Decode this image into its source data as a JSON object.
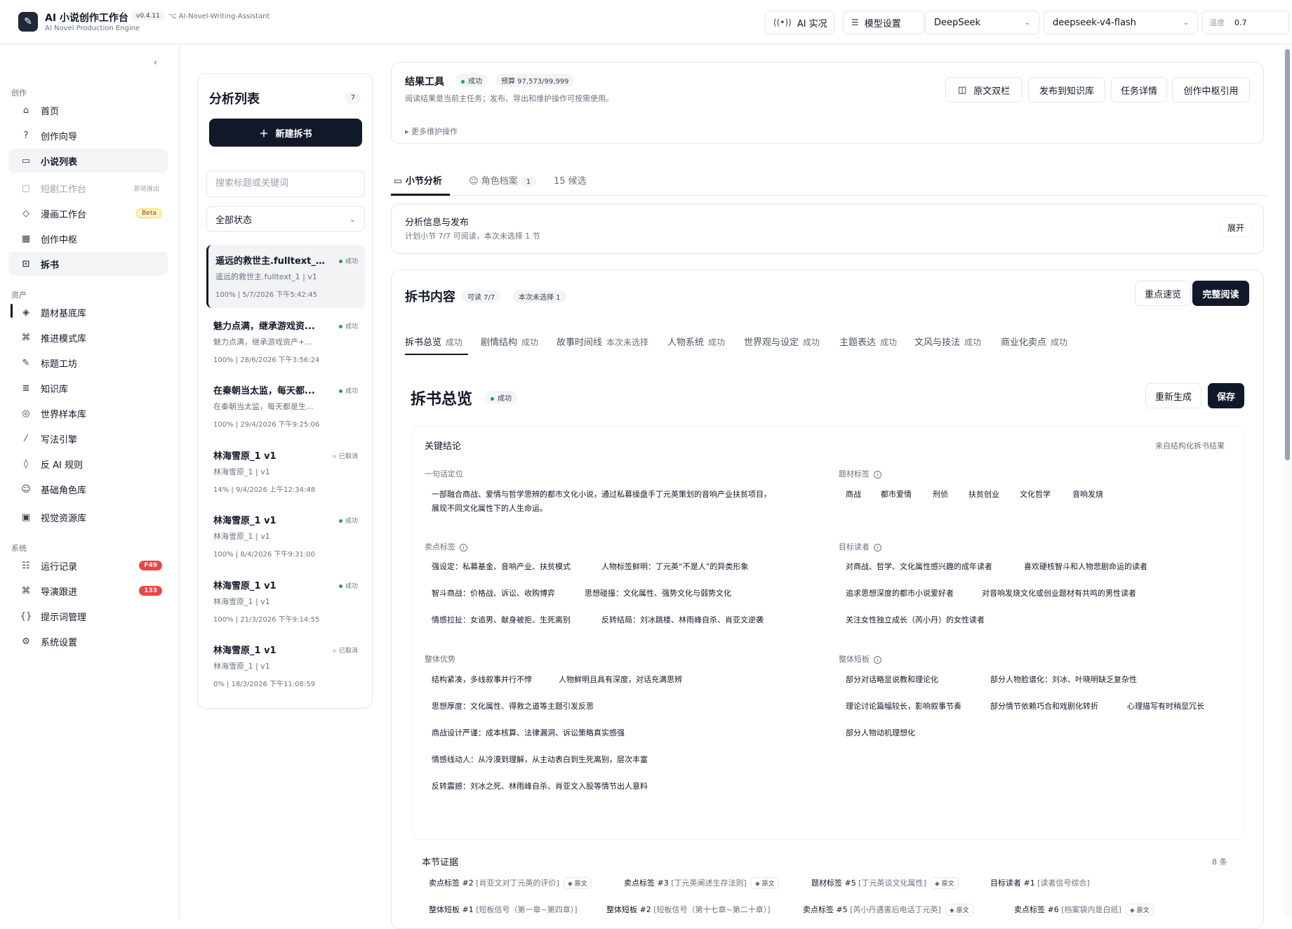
{
  "header": {
    "app_title": "AI 小说创作工作台",
    "app_subtitle": "AI Novel Production Engine",
    "version": "v0.4.11",
    "repo": "AI-Novel-Writing-Assistant",
    "live_button": "AI 实况",
    "model_settings_button": "模型设置",
    "provider_select": "DeepSeek",
    "model_select": "deepseek-v4-flash",
    "temperature_label": "温度",
    "temperature_value": "0.7"
  },
  "sidebar": {
    "section_create": "创作",
    "section_assets": "资产",
    "section_system": "系统",
    "items": [
      {
        "label": "首页"
      },
      {
        "label": "创作向导"
      },
      {
        "label": "小说列表"
      },
      {
        "label": "短剧工作台",
        "tag": "即将推出"
      },
      {
        "label": "漫画工作台",
        "badge": "Beta"
      },
      {
        "label": "创作中枢"
      },
      {
        "label": "拆书"
      },
      {
        "label": "题材基底库"
      },
      {
        "label": "推进模式库"
      },
      {
        "label": "标题工坊"
      },
      {
        "label": "知识库"
      },
      {
        "label": "世界样本库"
      },
      {
        "label": "写法引擎"
      },
      {
        "label": "反 AI 规则"
      },
      {
        "label": "基础角色库"
      },
      {
        "label": "视觉资源库"
      },
      {
        "label": "运行记录",
        "count": "F49"
      },
      {
        "label": "导演跟进",
        "count": "133"
      },
      {
        "label": "提示词管理"
      },
      {
        "label": "系统设置"
      }
    ]
  },
  "analysis_list": {
    "title": "分析列表",
    "count": "7",
    "new_button": "新建拆书",
    "search_placeholder": "搜索标题或关键词",
    "status_filter": "全部状态",
    "items": [
      {
        "title": "遥远的救世主.fulltext_1...",
        "status": "成功",
        "subtitle": "遥远的救世主.fulltext_1 | v1",
        "meta": "100% | 5/7/2026 下午5:42:45"
      },
      {
        "title": "魅力点满，继承游戏资...",
        "status": "成功",
        "subtitle": "魅力点满，继承游戏资产+...",
        "meta": "100% | 28/6/2026 下午3:56:24"
      },
      {
        "title": "在秦朝当太监，每天都...",
        "status": "成功",
        "subtitle": "在秦朝当太监，每天都是生...",
        "meta": "100% | 29/4/2026 下午9:25:06"
      },
      {
        "title": "林海雪原_1 v1",
        "status": "已取消",
        "subtitle": "林海雪原_1 | v1",
        "meta": "14% | 9/4/2026 上午12:34:48"
      },
      {
        "title": "林海雪原_1 v1",
        "status": "成功",
        "subtitle": "林海雪原_1 | v1",
        "meta": "100% | 8/4/2026 下午9:31:00"
      },
      {
        "title": "林海雪原_1 v1",
        "status": "成功",
        "subtitle": "林海雪原_1 | v1",
        "meta": "100% | 21/3/2026 下午9:14:55"
      },
      {
        "title": "林海雪原_1 v1",
        "status": "已取消",
        "subtitle": "林海雪原_1 | v1",
        "meta": "0% | 18/3/2026 下午11:08:59"
      }
    ]
  },
  "result_tools": {
    "title": "结果工具",
    "status": "成功",
    "budget": "预算 97,573/99,999",
    "description": "阅读结果是当前主任务；发布、导出和维护操作可按需使用。",
    "more": "更多维护操作",
    "buttons": [
      "原文双栏",
      "发布到知识库",
      "任务详情",
      "创作中枢引用"
    ]
  },
  "tabs": {
    "section_analysis": "小节分析",
    "character_profile": "角色档案",
    "character_count": "1",
    "candidates": "15 候选"
  },
  "publish_info": {
    "title": "分析信息与发布",
    "subtitle": "计划小节 7/7 可阅读，本次未选择 1 节",
    "expand": "展开"
  },
  "content": {
    "title": "拆书内容",
    "readable": "可读 7/7",
    "unselected": "本次未选择 1",
    "quick_view": "重点速览",
    "full_read": "完整阅读",
    "subtabs": [
      {
        "label": "拆书总览",
        "status": "成功"
      },
      {
        "label": "剧情结构",
        "status": "成功"
      },
      {
        "label": "故事时间线",
        "status": "本次未选择"
      },
      {
        "label": "人物系统",
        "status": "成功"
      },
      {
        "label": "世界观与设定",
        "status": "成功"
      },
      {
        "label": "主题表达",
        "status": "成功"
      },
      {
        "label": "文风与技法",
        "status": "成功"
      },
      {
        "label": "商业化卖点",
        "status": "成功"
      }
    ]
  },
  "overview": {
    "title": "拆书总览",
    "status": "成功",
    "regenerate": "重新生成",
    "save": "保存",
    "key_conclusions": "关键结论",
    "source": "来自结构化拆书结果",
    "one_line_label": "一句话定位",
    "one_line_1": "一部融合商战、爱情与哲学思辨的都市文化小说，通过私募操盘手丁元英策划的音响产业扶贫项目，",
    "one_line_2": "展现不同文化属性下的人生命运。",
    "genre_label": "题材标签",
    "genre_tags": [
      "商战",
      "都市爱情",
      "刑侦",
      "扶贫创业",
      "文化哲学",
      "音响发烧"
    ],
    "selling_label": "卖点标签",
    "selling_tags": [
      "强设定：私募基金、音响产业、扶贫模式",
      "人物标签鲜明：丁元英“不是人”的异类形象",
      "智斗商战：价格战、诉讼、收购博弈",
      "思想碰撞：文化属性、强势文化与弱势文化",
      "情感拉扯：女追男、献身被拒、生死离别",
      "反转结局：刘冰跳楼、林雨峰自杀、肖亚文逆袭"
    ],
    "target_label": "目标读者",
    "target_tags": [
      "对商战、哲学、文化属性感兴趣的成年读者",
      "喜欢硬核智斗和人物悲剧命运的读者",
      "追求思想深度的都市小说爱好者",
      "对音响发烧文化或创业题材有共鸣的男性读者",
      "关注女性独立成长（芮小丹）的女性读者"
    ],
    "strengths_label": "整体优势",
    "strengths": [
      "结构紧凑，多线叙事并行不悖",
      "人物鲜明且具有深度，对话充满思辨",
      "思想厚度：文化属性、得救之道等主题引发反思",
      "商战设计严谨：成本核算、法律漏洞、诉讼策略真实感强",
      "情感线动人：从冷漠到理解，从主动表白到生死离别，层次丰富",
      "反转震撼：刘冰之死、林雨峰自杀、肖亚文入股等情节出人意料"
    ],
    "weakness_label": "整体短板",
    "weaknesses": [
      "部分对话略显说教和理论化",
      "部分人物脸谱化：刘冰、叶晓明缺乏复杂性",
      "理论讨论篇幅较长，影响叙事节奏",
      "部分情节依赖巧合和戏剧化转折",
      "心理描写有时稍显冗长",
      "部分人物动机理想化"
    ]
  },
  "evidence": {
    "title": "本节证据",
    "count": "8 条",
    "source_label": "原文",
    "items": [
      {
        "name": "卖点标签 #2",
        "quote": "[肖亚文对丁元英的评价]",
        "has_source": true
      },
      {
        "name": "卖点标签 #3",
        "quote": "[丁元英阐述生存法则]",
        "has_source": true
      },
      {
        "name": "题材标签 #5",
        "quote": "[丁元英谈文化属性]",
        "has_source": true
      },
      {
        "name": "目标读者 #1",
        "quote": "[读者信号综合]",
        "has_source": false
      },
      {
        "name": "整体短板 #1",
        "quote": "[短板信号（第一章~第四章）]",
        "has_source": false
      },
      {
        "name": "整体短板 #2",
        "quote": "[短板信号（第十七章~第二十章）]",
        "has_source": true
      },
      {
        "name": "卖点标签 #5",
        "quote": "[芮小丹遇害后电话丁元英]",
        "has_source": true
      },
      {
        "name": "卖点标签 #6",
        "quote": "[档案袋内是白纸]",
        "has_source": true
      }
    ]
  }
}
